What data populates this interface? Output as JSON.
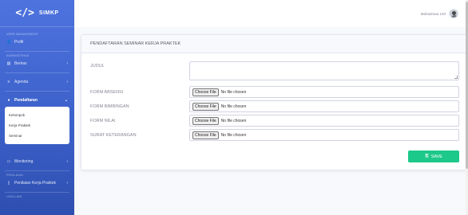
{
  "brand": {
    "icon": "</>",
    "name": "SIMKP"
  },
  "sidebar": {
    "headings": {
      "user_management": "USER MANAGEMENT",
      "administrasi": "ADMINISTRASI",
      "penilaian": "PENILAIAN",
      "lain_lain": "LAIN-LAIN"
    },
    "profil": "Profil",
    "berkas": "Berkas",
    "agenda": "Agenda",
    "pendaftaran": "Pendaftaran",
    "submenu": [
      "Kelompok",
      "Kerja Praktek",
      "Seminar"
    ],
    "monitoring": "Monitoring",
    "penilaian_kp": "Penilaian Kerja Praktek"
  },
  "topbar": {
    "user_name": "Mahasiswa 140"
  },
  "form": {
    "title": "PENDAFTARAN SEMINAR KERJA PRAKTEK",
    "judul_label": "JUDUL",
    "file_button": "Choose File",
    "file_status": "No file chosen",
    "fields": [
      "FORM ABSENSI",
      "FORM BIMBINGAN",
      "FORM NILAI",
      "SURAT KETERANGAN"
    ],
    "save_label": "SAVE"
  },
  "colors": {
    "sidebar": "#4e73df",
    "save": "#1cc88a"
  }
}
